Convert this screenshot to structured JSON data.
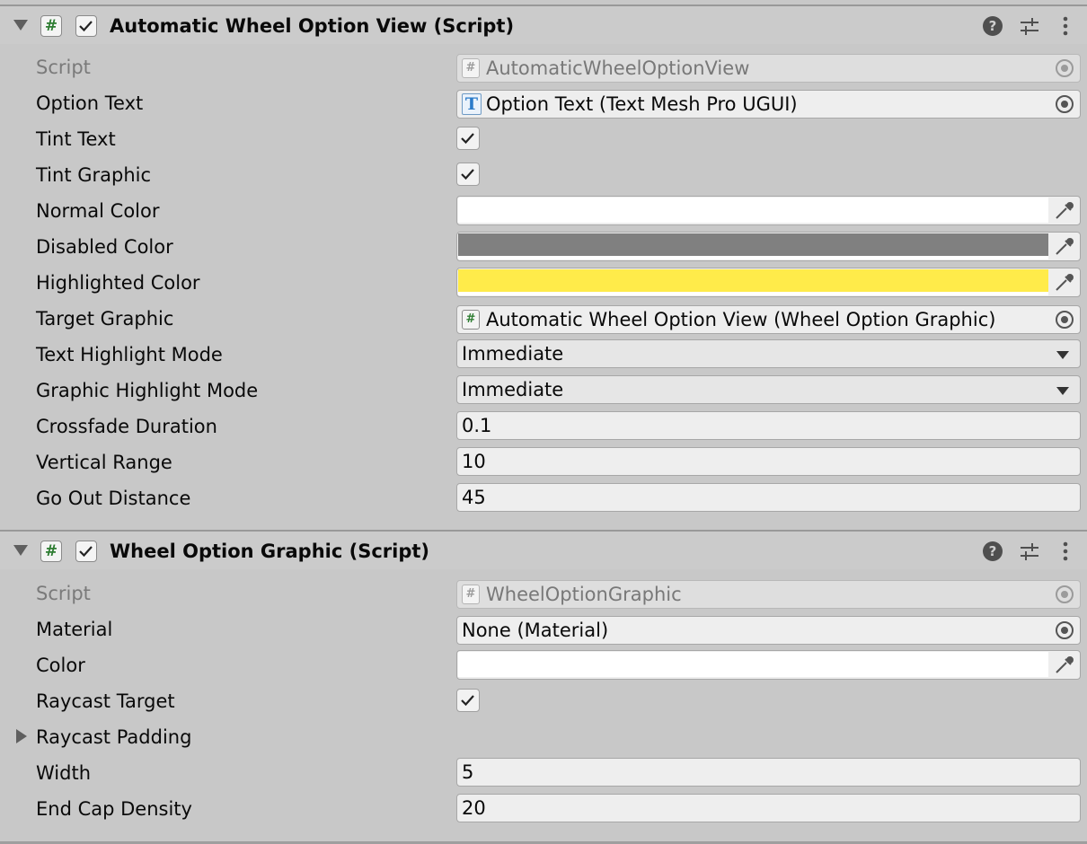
{
  "components": [
    {
      "title": "Automatic Wheel Option View (Script)",
      "enabled": true,
      "properties": {
        "script": {
          "label": "Script",
          "value": "AutomaticWheelOptionView"
        },
        "option_text": {
          "label": "Option Text",
          "value": "Option Text (Text Mesh Pro UGUI)"
        },
        "tint_text": {
          "label": "Tint Text",
          "checked": true
        },
        "tint_graphic": {
          "label": "Tint Graphic",
          "checked": true
        },
        "normal_color": {
          "label": "Normal Color",
          "color": "#ffffff"
        },
        "disabled_color": {
          "label": "Disabled Color",
          "color": "#808080"
        },
        "highlighted_color": {
          "label": "Highlighted Color",
          "color": "#ffeb4a"
        },
        "target_graphic": {
          "label": "Target Graphic",
          "value": "Automatic Wheel Option View (Wheel Option Graphic)"
        },
        "text_highlight_mode": {
          "label": "Text Highlight Mode",
          "value": "Immediate"
        },
        "graphic_highlight_mode": {
          "label": "Graphic Highlight Mode",
          "value": "Immediate"
        },
        "crossfade_duration": {
          "label": "Crossfade Duration",
          "value": "0.1"
        },
        "vertical_range": {
          "label": "Vertical Range",
          "value": "10"
        },
        "go_out_distance": {
          "label": "Go Out Distance",
          "value": "45"
        }
      }
    },
    {
      "title": "Wheel Option Graphic (Script)",
      "enabled": true,
      "properties": {
        "script": {
          "label": "Script",
          "value": "WheelOptionGraphic"
        },
        "material": {
          "label": "Material",
          "value": "None (Material)"
        },
        "color": {
          "label": "Color",
          "color": "#ffffff"
        },
        "raycast_target": {
          "label": "Raycast Target",
          "checked": true
        },
        "raycast_padding": {
          "label": "Raycast Padding"
        },
        "width": {
          "label": "Width",
          "value": "5"
        },
        "end_cap_density": {
          "label": "End Cap Density",
          "value": "20"
        }
      }
    }
  ],
  "icons": {
    "script_badge": "#",
    "text_mesh_pro": "T",
    "help": "?"
  },
  "colors": {
    "panel_bg": "#c8c8c8",
    "script_green": "#2e7d32"
  }
}
